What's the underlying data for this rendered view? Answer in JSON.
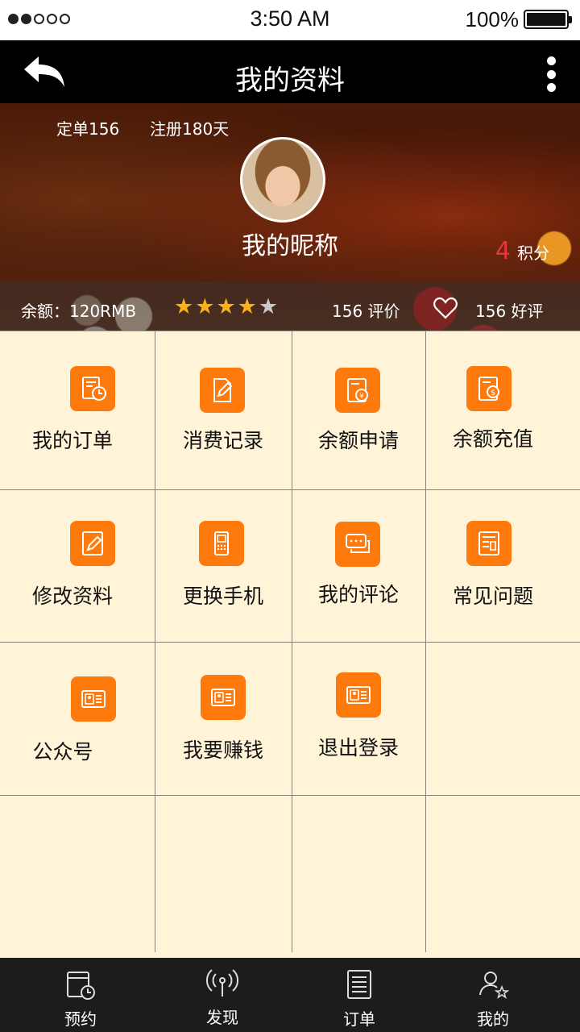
{
  "status_bar": {
    "time": "3:50 AM",
    "battery_text": "100%",
    "signal_dots_on": 2,
    "signal_dots_total": 5
  },
  "nav": {
    "title": "我的资料",
    "back_icon": "back-arrow-icon",
    "more_icon": "more-vertical-icon"
  },
  "profile": {
    "orders": "定单156",
    "register": "注册180天",
    "nickname": "我的昵称",
    "points_value": "4",
    "points_label": "积分",
    "balance": "余额：120RMB",
    "rating": 4,
    "rating_max": 5,
    "reviews": "156 评价",
    "good_reviews": "156  好评"
  },
  "menu": [
    {
      "label": "我的订单",
      "icon": "order-clock-icon"
    },
    {
      "label": "消费记录",
      "icon": "edit-note-icon"
    },
    {
      "label": "余额申请",
      "icon": "yuan-doc-icon"
    },
    {
      "label": "余额充值",
      "icon": "dollar-doc-icon"
    },
    {
      "label": "修改资料",
      "icon": "edit-profile-icon"
    },
    {
      "label": "更换手机",
      "icon": "phone-icon"
    },
    {
      "label": "我的评论",
      "icon": "comment-icon"
    },
    {
      "label": "常见问题",
      "icon": "faq-icon"
    },
    {
      "label": "公众号",
      "icon": "id-card-icon"
    },
    {
      "label": "我要赚钱",
      "icon": "id-card-icon"
    },
    {
      "label": "退出登录",
      "icon": "id-card-icon"
    }
  ],
  "tabs": [
    {
      "label": "预约",
      "icon": "calendar-clock-icon"
    },
    {
      "label": "发现",
      "icon": "broadcast-icon"
    },
    {
      "label": "订单",
      "icon": "list-doc-icon"
    },
    {
      "label": "我的",
      "icon": "user-star-icon"
    }
  ],
  "colors": {
    "accent": "#ff7a0d",
    "grid_bg": "#fff4d8",
    "star_on": "#f9b21a",
    "points_red": "#e8353a",
    "tabbar_bg": "#1d1c1d"
  }
}
